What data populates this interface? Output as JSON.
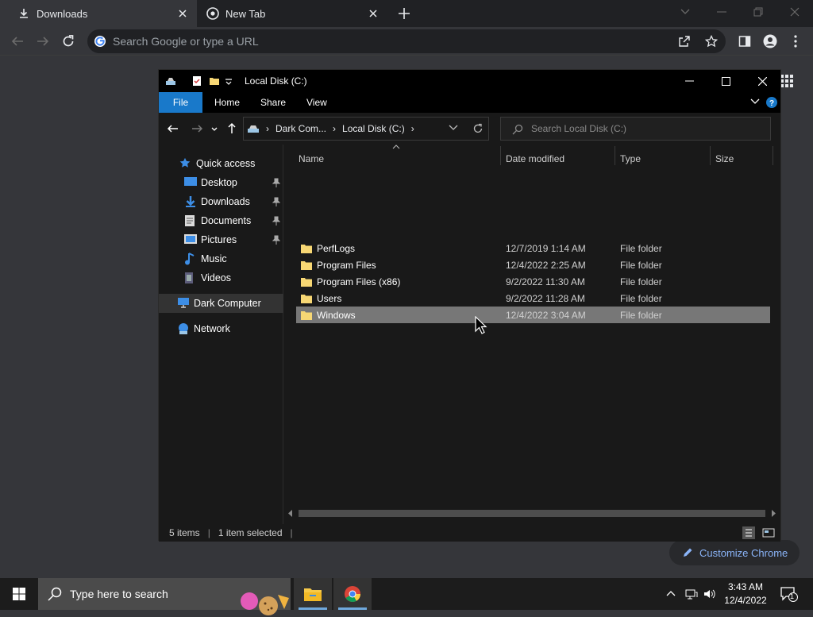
{
  "browser": {
    "tabs": [
      {
        "label": "Downloads",
        "icon": "download-icon",
        "active": true
      },
      {
        "label": "New Tab",
        "icon": "chrome-icon",
        "active": false
      }
    ],
    "omnibox_placeholder": "Search Google or type a URL",
    "customize_label": "Customize Chrome"
  },
  "explorer": {
    "title": "Local Disk (C:)",
    "ribbon_tabs": [
      "File",
      "Home",
      "Share",
      "View"
    ],
    "breadcrumb": [
      "Dark Com...",
      "Local Disk (C:)"
    ],
    "search_placeholder": "Search Local Disk (C:)",
    "nav": {
      "quick_access": "Quick access",
      "items": [
        {
          "label": "Desktop",
          "icon": "desktop-icon",
          "pinned": true
        },
        {
          "label": "Downloads",
          "icon": "download-icon",
          "pinned": true
        },
        {
          "label": "Documents",
          "icon": "documents-icon",
          "pinned": true
        },
        {
          "label": "Pictures",
          "icon": "pictures-icon",
          "pinned": true
        },
        {
          "label": "Music",
          "icon": "music-icon",
          "pinned": false
        },
        {
          "label": "Videos",
          "icon": "videos-icon",
          "pinned": false
        }
      ],
      "this_pc": "Dark Computer",
      "network": "Network"
    },
    "columns": [
      "Name",
      "Date modified",
      "Type",
      "Size"
    ],
    "files": [
      {
        "name": "PerfLogs",
        "date": "12/7/2019 1:14 AM",
        "type": "File folder",
        "selected": false
      },
      {
        "name": "Program Files",
        "date": "12/4/2022 2:25 AM",
        "type": "File folder",
        "selected": false
      },
      {
        "name": "Program Files (x86)",
        "date": "9/2/2022 11:30 AM",
        "type": "File folder",
        "selected": false
      },
      {
        "name": "Users",
        "date": "9/2/2022 11:28 AM",
        "type": "File folder",
        "selected": false
      },
      {
        "name": "Windows",
        "date": "12/4/2022 3:04 AM",
        "type": "File folder",
        "selected": true
      }
    ],
    "status": {
      "items": "5 items",
      "selected": "1 item selected"
    }
  },
  "taskbar": {
    "search_placeholder": "Type here to search",
    "time": "3:43 AM",
    "date": "12/4/2022",
    "notification_count": "1"
  },
  "colors": {
    "accent": "#1979ca",
    "selected_row": "#777777",
    "link": "#8ab4f8"
  }
}
